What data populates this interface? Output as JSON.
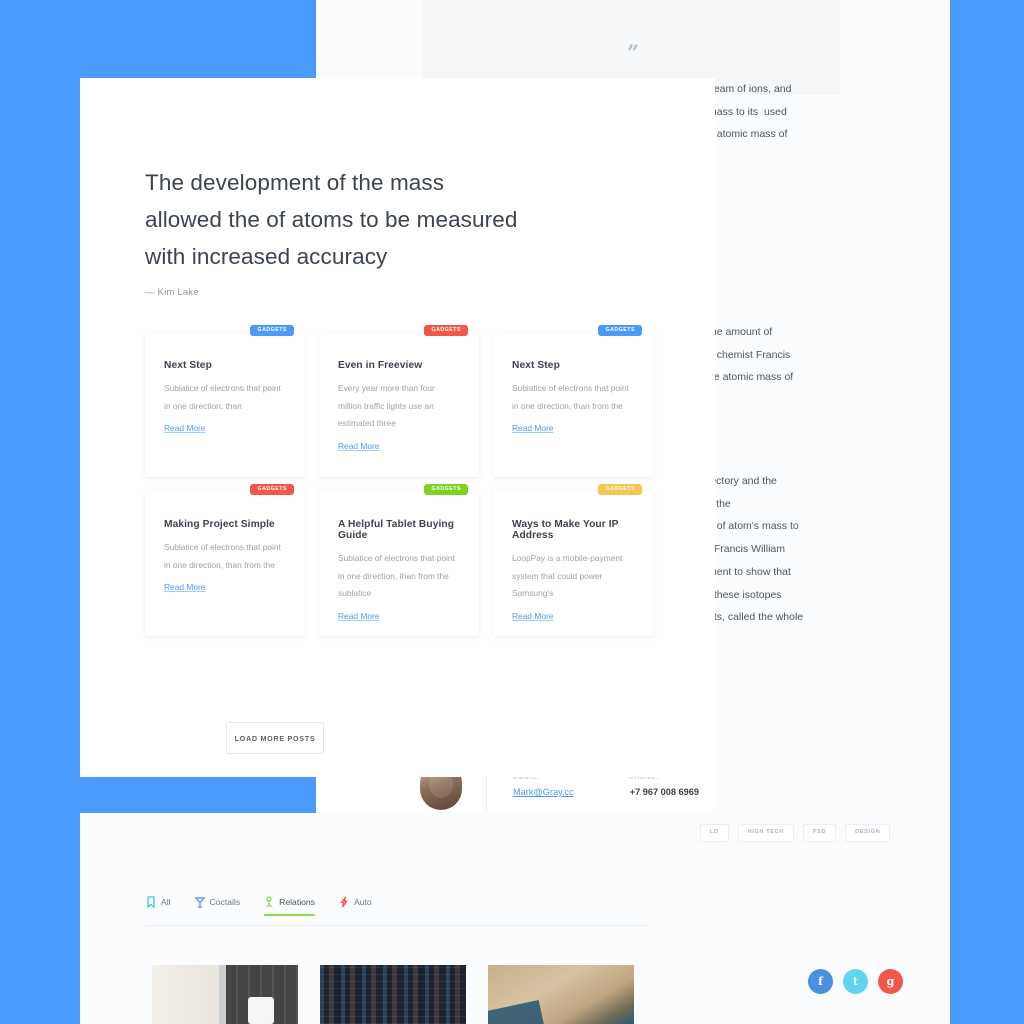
{
  "theme": {
    "accent_blue": "#4a9afa",
    "badge_blue": "#4a9afa",
    "badge_red": "#f2584a",
    "badge_green": "#7ed321",
    "badge_yellow": "#f5c451",
    "active_tab_underline": "#8cd94a"
  },
  "hero": {
    "quote_icon": "quote-mark-icon",
    "title": "The development of the mass allowed the of atoms to be measured with increased accuracy",
    "author": "— Kim Lake"
  },
  "posts": [
    {
      "badge": "GADGETS",
      "badge_color": "#4a9afa",
      "title": "Next Step",
      "excerpt": "Sublatice of electrons that point in one direction, than",
      "link": "Read More"
    },
    {
      "badge": "GADGETS",
      "badge_color": "#f2584a",
      "title": "Even in Freeview",
      "excerpt": "Every year more than four million traffic lights use an estimated three",
      "link": "Read More"
    },
    {
      "badge": "GADGETS",
      "badge_color": "#4a9afa",
      "title": "Next Step",
      "excerpt": "Sublatice of electrons that point in one direction, than from the",
      "link": "Read More"
    },
    {
      "badge": "GADGETS",
      "badge_color": "#f2584a",
      "title": "Making Project Simple",
      "excerpt": "Sublatice of electrons that point in one direction, than from the",
      "link": "Read More"
    },
    {
      "badge": "GADGETS",
      "badge_color": "#7ed321",
      "title": "A Helpful Tablet Buying Guide",
      "excerpt": "Sublatice of electrons that point in one direction, than from the sublatice",
      "link": "Read More"
    },
    {
      "badge": "GADGETS",
      "badge_color": "#f5c451",
      "title": "Ways to Make Your IP Address",
      "excerpt": "LoopPay is a mobile-payment system that could power Samsung's",
      "link": "Read More"
    }
  ],
  "load_more": {
    "label": "LOAD MORE POSTS"
  },
  "background_text": {
    "block1": "beam of ions, and\nmass to its  used\ne atomic mass of",
    "block2": "the amount of\ne chemist Francis\nhe atomic mass of",
    "block3": "jectory and the\ns the\no of atom's mass to\nt Francis William\nment to show that\nf these isotopes\nnts, called the whole"
  },
  "contact": {
    "avatar": "user-avatar",
    "email_label": "EMAIL:",
    "email_value": "Mark@Gray.cc",
    "phone_label": "PHONE:",
    "phone_value": "+7 967 008 6969"
  },
  "tags": [
    {
      "label": "LD"
    },
    {
      "label": "HIGH TECH"
    },
    {
      "label": "PSD"
    },
    {
      "label": "DESIGN"
    }
  ],
  "tabs": [
    {
      "label": "All",
      "icon": "bookmark-icon",
      "color": "#3fc8c0",
      "active": false
    },
    {
      "label": "Coctails",
      "icon": "cocktail-glass-icon",
      "color": "#4a9afa",
      "active": false
    },
    {
      "label": "Relations",
      "icon": "person-icon",
      "color": "#8cd94a",
      "active": true
    },
    {
      "label": "Auto",
      "icon": "lightning-icon",
      "color": "#f2584a",
      "active": false
    }
  ],
  "thumbnails": [
    {
      "name": "notebook-keyboard-thumbnail"
    },
    {
      "name": "code-editor-thumbnail"
    },
    {
      "name": "aerial-coastline-thumbnail"
    }
  ],
  "social": [
    {
      "name": "facebook-icon",
      "glyph": "f",
      "color": "#4a90e2"
    },
    {
      "name": "twitter-icon",
      "glyph": "t",
      "color": "#62d4f0"
    },
    {
      "name": "google-plus-icon",
      "glyph": "g",
      "color": "#f2584a"
    }
  ]
}
